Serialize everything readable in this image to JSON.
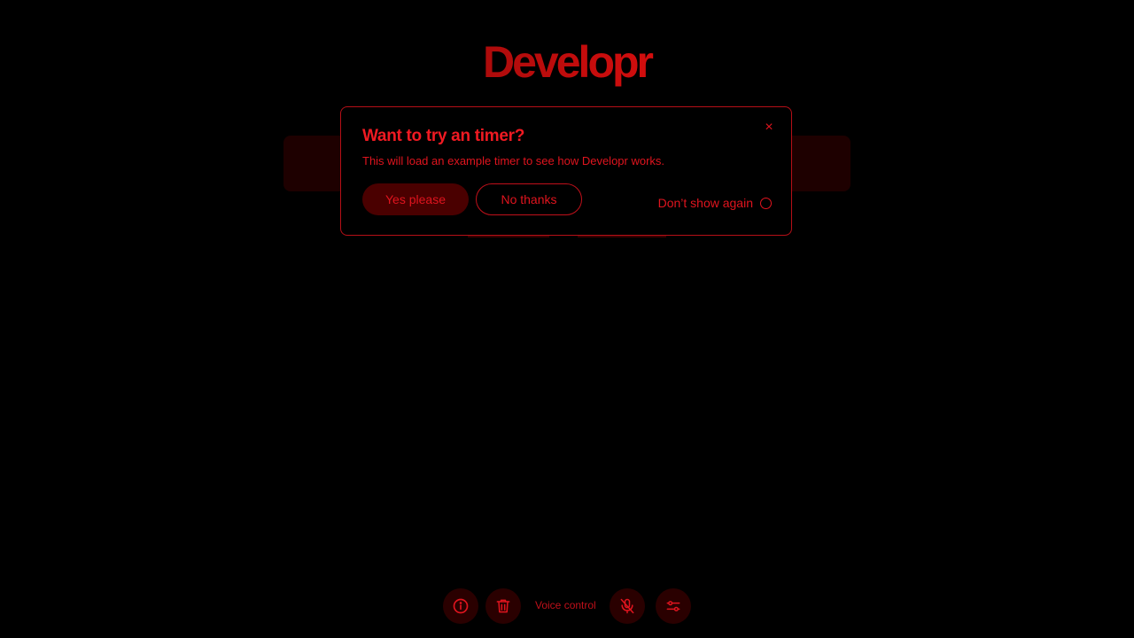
{
  "app": {
    "logo_text": "Developr"
  },
  "modal": {
    "title": "Want to try an timer?",
    "description": "This will load an example timer to see how Developr works.",
    "close_label": "×",
    "yes_label": "Yes please",
    "no_label": "No thanks",
    "dont_show_label": "Don’t show again",
    "dont_show_checked": false
  },
  "toolbar": {
    "voice_label": "Voice control",
    "icons": [
      "info-icon",
      "trash-icon",
      "mic-off-icon",
      "sliders-icon"
    ]
  },
  "colors": {
    "accent": "#e0141e",
    "button_bg": "#2a0000",
    "background": "#000000"
  }
}
